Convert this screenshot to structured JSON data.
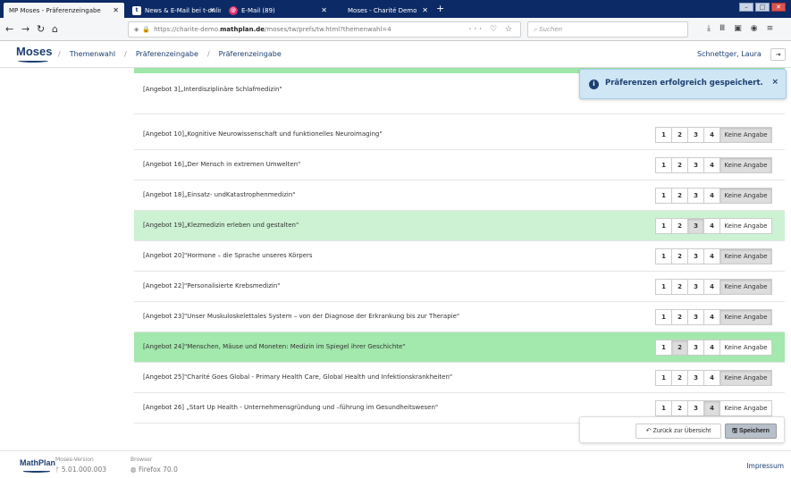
{
  "browser": {
    "tabs": [
      {
        "label": "MP Moses - Präferenzeingabe",
        "active": true
      },
      {
        "label": "News & E-Mail bei t-online.de"
      },
      {
        "label": "E-Mail (89)"
      },
      {
        "label": "Moses - Charité Demo"
      }
    ],
    "url_prefix": "https://charite-demo.",
    "url_host": "mathplan.de",
    "url_path": "/moses/tw/prefs/tw.html?themenwahl=4",
    "search_placeholder": "Suchen",
    "colors": {
      "tabbar": "#0b2a66",
      "accent": "#1d3f72"
    }
  },
  "header": {
    "logo": "Moses",
    "breadcrumbs": [
      "Themenwahl",
      "Präferenzeingabe",
      "Präferenzeingabe"
    ],
    "user": "Schnettger, Laura"
  },
  "toast": {
    "message": "Präferenzen erfolgreich gespeichert.",
    "close": "×"
  },
  "options": [
    "1",
    "2",
    "3",
    "4",
    "Keine Angabe"
  ],
  "rows": [
    {
      "label": "[Angebot 3]„Interdisziplinäre Schlafmedizin\"",
      "selected": null,
      "highlight": ""
    },
    {
      "label": "[Angebot 10]„Kognitive Neurowissenschaft und funktionelles Neuroimaging\"",
      "selected": "Keine Angabe",
      "highlight": ""
    },
    {
      "label": "[Angebot 16]„Der Mensch in extremen Umwelten\"",
      "selected": "Keine Angabe",
      "highlight": ""
    },
    {
      "label": "[Angebot 18]„Einsatz- undKatastrophenmedizin\"",
      "selected": "Keine Angabe",
      "highlight": ""
    },
    {
      "label": "[Angebot 19]„Klezmedizin erleben und gestalten\"",
      "selected": "3",
      "highlight": "green"
    },
    {
      "label": "[Angebot 20]\"Hormone – die Sprache unseres Körpers",
      "selected": "Keine Angabe",
      "highlight": ""
    },
    {
      "label": "[Angebot 22]\"Personalisierte Krebsmedizin\"",
      "selected": "Keine Angabe",
      "highlight": ""
    },
    {
      "label": "[Angebot 23]\"Unser Muskuloskelettales System – von der Diagnose der Erkrankung bis zur Therapie\"",
      "selected": "Keine Angabe",
      "highlight": ""
    },
    {
      "label": "[Angebot 24]\"Menschen, Mäuse und Moneten: Medizin im Spiegel ihrer Geschichte\"",
      "selected": "2",
      "highlight": "green2"
    },
    {
      "label": "[Angebot 25]\"Charité Goes Global - Primary Health Care, Global Health und Infektionskrankheiten\"",
      "selected": "Keine Angabe",
      "highlight": ""
    },
    {
      "label": "[Angebot 26] „Start Up Health - Unternehmensgründung und –führung im Gesundheitswesen\"",
      "selected": "4",
      "highlight": ""
    }
  ],
  "actions": {
    "back": "Zurück zur Übersicht",
    "save": "Speichern"
  },
  "footer": {
    "logo": "MathPlan",
    "version_label": "Moses-Version",
    "version": "5.01.000.003",
    "browser_label": "Browser",
    "browser": "Firefox 70.0",
    "impressum": "Impressum"
  }
}
